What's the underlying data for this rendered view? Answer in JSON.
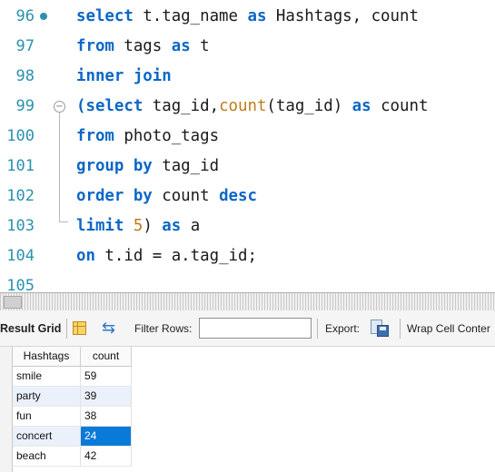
{
  "editor": {
    "lines": [
      {
        "num": "96",
        "parts": [
          [
            "kw",
            "select"
          ],
          [
            "id",
            " t.tag_name "
          ],
          [
            "kw",
            "as"
          ],
          [
            "id",
            " Hashtags, count"
          ]
        ]
      },
      {
        "num": "97",
        "parts": [
          [
            "kw",
            "from"
          ],
          [
            "id",
            " tags "
          ],
          [
            "kw",
            "as"
          ],
          [
            "id",
            " t"
          ]
        ]
      },
      {
        "num": "98",
        "parts": [
          [
            "kw",
            "inner join"
          ]
        ]
      },
      {
        "num": "99",
        "parts": [
          [
            "kw",
            "(select"
          ],
          [
            "id",
            " tag_id,"
          ],
          [
            "fn",
            "count"
          ],
          [
            "id",
            "(tag_id) "
          ],
          [
            "kw",
            "as"
          ],
          [
            "id",
            " count"
          ]
        ]
      },
      {
        "num": "100",
        "parts": [
          [
            "kw",
            "from"
          ],
          [
            "id",
            " photo_tags"
          ]
        ]
      },
      {
        "num": "101",
        "parts": [
          [
            "kw",
            "group by"
          ],
          [
            "id",
            " tag_id"
          ]
        ]
      },
      {
        "num": "102",
        "parts": [
          [
            "kw",
            "order by"
          ],
          [
            "id",
            " count "
          ],
          [
            "kw",
            "desc"
          ]
        ]
      },
      {
        "num": "103",
        "parts": [
          [
            "kw",
            "limit"
          ],
          [
            "id",
            " "
          ],
          [
            "num",
            "5"
          ],
          [
            "id",
            ") "
          ],
          [
            "kw",
            "as"
          ],
          [
            "id",
            " a"
          ]
        ]
      },
      {
        "num": "104",
        "parts": [
          [
            "kw",
            "on"
          ],
          [
            "id",
            " t.id = a.tag_id;"
          ]
        ]
      },
      {
        "num": "105",
        "parts": []
      }
    ]
  },
  "toolbar": {
    "result_grid_label": "Result Grid",
    "filter_label": "Filter Rows:",
    "filter_value": "",
    "export_label": "Export:",
    "wrap_label": "Wrap Cell Conter"
  },
  "grid": {
    "columns": [
      "Hashtags",
      "count"
    ],
    "rows": [
      [
        "smile",
        "59"
      ],
      [
        "party",
        "39"
      ],
      [
        "fun",
        "38"
      ],
      [
        "concert",
        "24"
      ],
      [
        "beach",
        "42"
      ]
    ],
    "selected_cell": "24"
  },
  "colors": {
    "keyword": "#0c67c6",
    "function": "#c07a1a",
    "line_number": "#2b91af",
    "selection": "#0a7ad8",
    "alt_row": "#eaf1fb"
  }
}
